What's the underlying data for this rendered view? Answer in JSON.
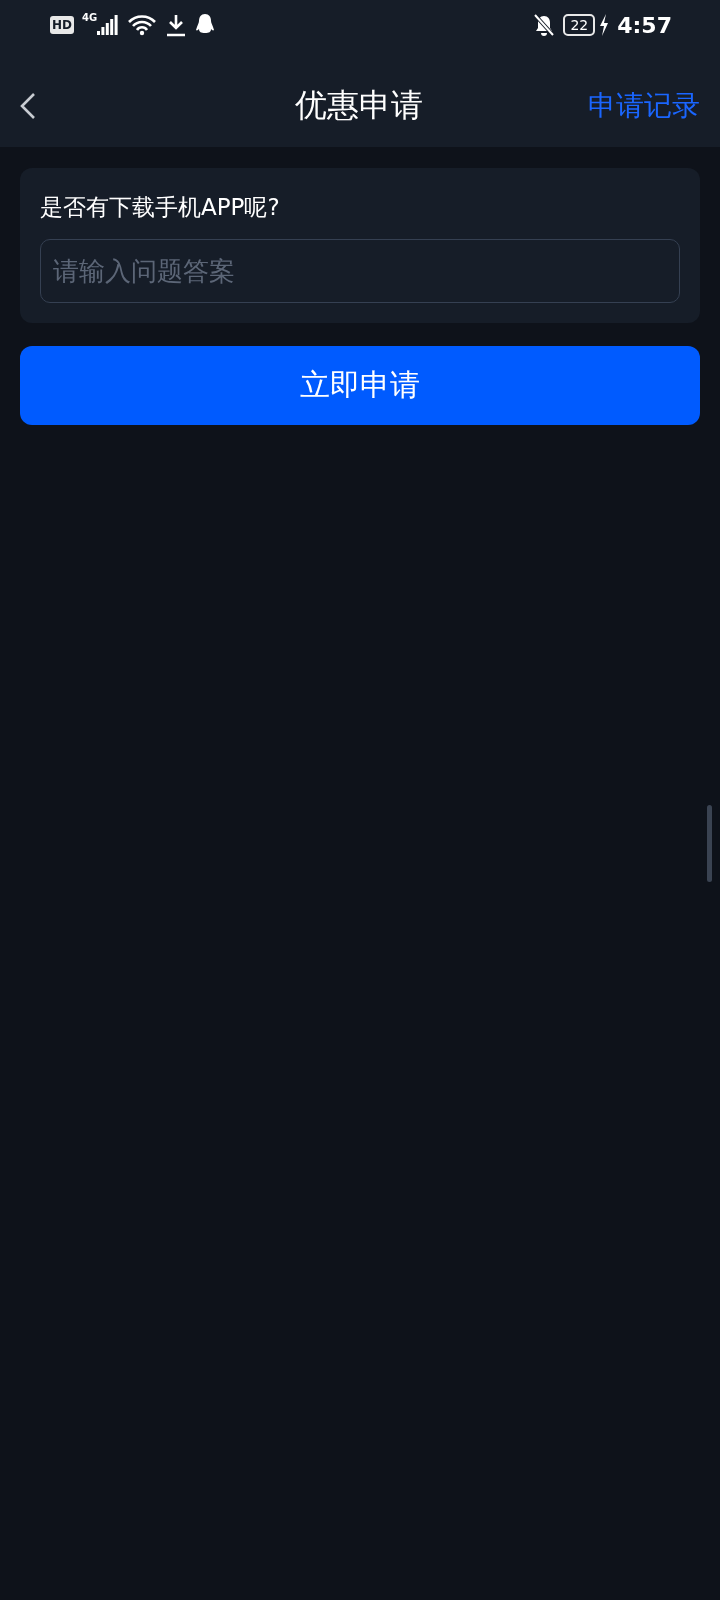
{
  "status_bar": {
    "hd": "HD",
    "network": "4G",
    "battery": "22",
    "time": "4:57"
  },
  "header": {
    "title": "优惠申请",
    "action": "申请记录"
  },
  "form": {
    "question": "是否有下载手机APP呢?",
    "placeholder": "请输入问题答案"
  },
  "submit": "立即申请"
}
